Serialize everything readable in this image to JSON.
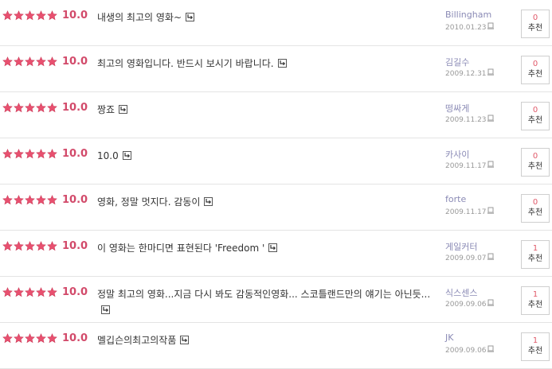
{
  "icons": {
    "star": "star-icon",
    "reply": "reply-arrow-icon",
    "report": "report-icon"
  },
  "colors": {
    "star": "#e8506f",
    "score": "#d24a6a",
    "author": "#8a8ab5",
    "rec_count": "#e05a6a"
  },
  "reviews": [
    {
      "stars": 5,
      "score": "10.0",
      "comment": "내생의 최고의 영화~",
      "author": "Billingham",
      "date": "2010.01.23",
      "rec_count": "0",
      "rec_label": "추천"
    },
    {
      "stars": 5,
      "score": "10.0",
      "comment": "최고의 영화입니다. 반드시 보시기 바랍니다.",
      "author": "김길수",
      "date": "2009.12.31",
      "rec_count": "0",
      "rec_label": "추천"
    },
    {
      "stars": 5,
      "score": "10.0",
      "comment": "짱죠",
      "author": "떵싸게",
      "date": "2009.11.23",
      "rec_count": "0",
      "rec_label": "추천"
    },
    {
      "stars": 5,
      "score": "10.0",
      "comment": "10.0",
      "author": "카사이",
      "date": "2009.11.17",
      "rec_count": "0",
      "rec_label": "추천"
    },
    {
      "stars": 5,
      "score": "10.0",
      "comment": "영화, 정말 멋지다. 감동이",
      "author": "forte",
      "date": "2009.11.17",
      "rec_count": "0",
      "rec_label": "추천"
    },
    {
      "stars": 5,
      "score": "10.0",
      "comment": "이 영화는 한마디면 표현된다 'Freedom '",
      "author": "게일커터",
      "date": "2009.09.07",
      "rec_count": "1",
      "rec_label": "추천"
    },
    {
      "stars": 5,
      "score": "10.0",
      "comment": "정말 최고의 영화...지금 다시 봐도 감동적인영화... 스코틀랜드만의 얘기는 아닌듯...",
      "author": "식스센스",
      "date": "2009.09.06",
      "rec_count": "1",
      "rec_label": "추천"
    },
    {
      "stars": 5,
      "score": "10.0",
      "comment": "멜깁슨의최고의작품",
      "author": "JK",
      "date": "2009.09.06",
      "rec_count": "1",
      "rec_label": "추천"
    }
  ]
}
